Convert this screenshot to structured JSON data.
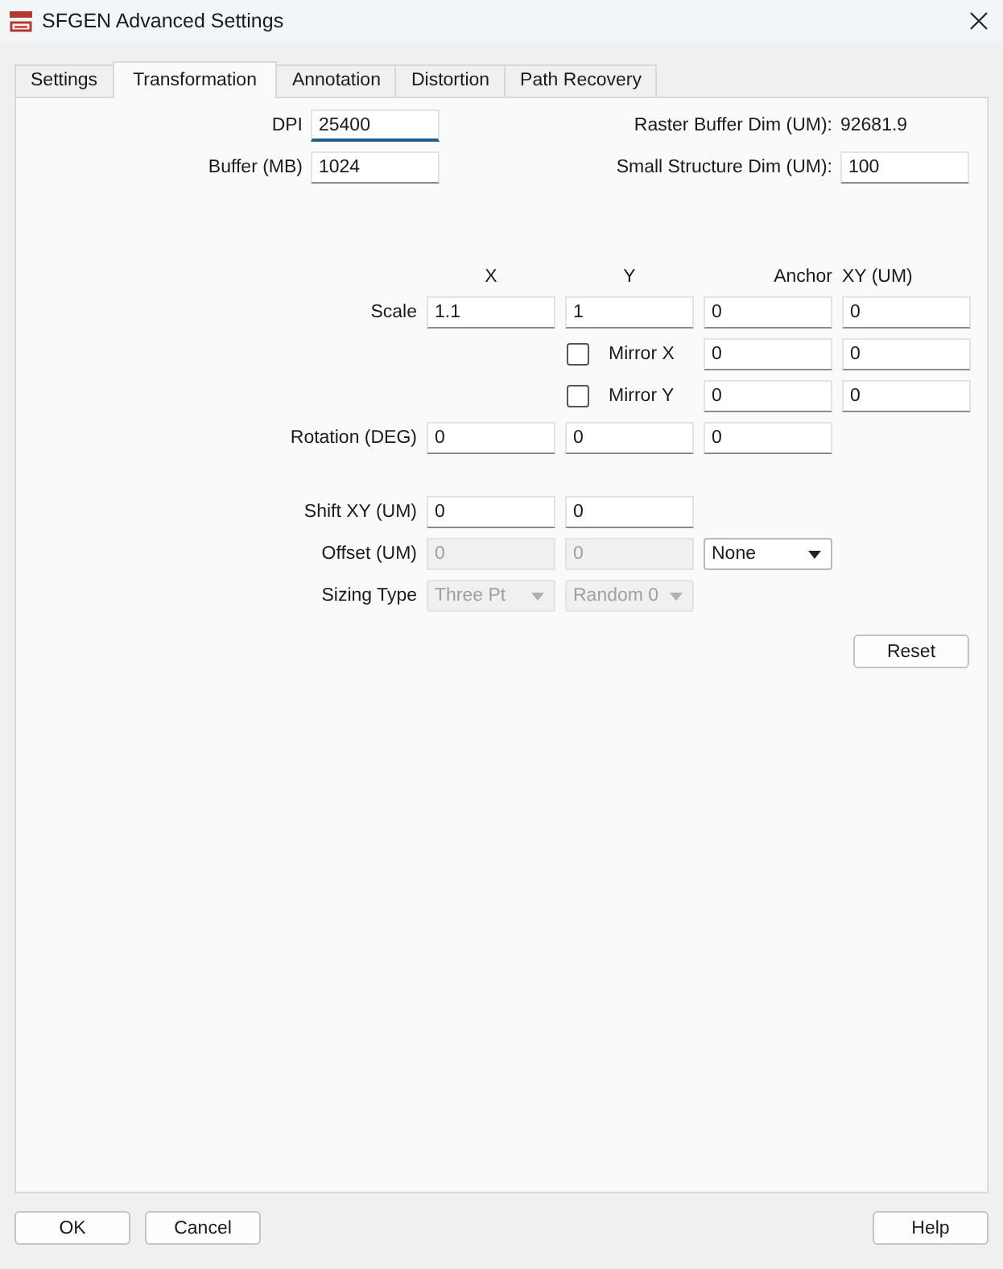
{
  "window": {
    "title": "SFGEN Advanced Settings"
  },
  "tabs": [
    {
      "label": "Settings",
      "selected": false
    },
    {
      "label": "Transformation",
      "selected": true
    },
    {
      "label": "Annotation",
      "selected": false
    },
    {
      "label": "Distortion",
      "selected": false
    },
    {
      "label": "Path Recovery",
      "selected": false
    }
  ],
  "top_left": [
    {
      "label": "DPI",
      "value": "25400",
      "focused": true
    },
    {
      "label": "Buffer (MB)",
      "value": "1024",
      "focused": false
    }
  ],
  "top_right": [
    {
      "label": "Raster Buffer Dim (UM):",
      "kind": "text",
      "value": "92681.9"
    },
    {
      "label": "Small Structure Dim (UM):",
      "kind": "field",
      "value": "100"
    }
  ],
  "column_headers": [
    "X",
    "Y",
    "Anchor",
    "XY (UM)"
  ],
  "sections": [
    {
      "rows": [
        {
          "label": "Scale",
          "cells": [
            {
              "kind": "field",
              "value": "1.1",
              "disabled": false
            },
            {
              "kind": "field",
              "value": "1",
              "disabled": false
            },
            {
              "kind": "field",
              "value": "0",
              "disabled": false
            },
            {
              "kind": "field",
              "value": "0",
              "disabled": false
            }
          ]
        },
        {
          "cells": [
            null,
            {
              "kind": "checkbox",
              "label": "Mirror X",
              "checked": false
            },
            {
              "kind": "field",
              "value": "0",
              "disabled": false
            },
            {
              "kind": "field",
              "value": "0",
              "disabled": false
            }
          ]
        },
        {
          "cells": [
            null,
            {
              "kind": "checkbox",
              "label": "Mirror Y",
              "checked": false
            },
            {
              "kind": "field",
              "value": "0",
              "disabled": false
            },
            {
              "kind": "field",
              "value": "0",
              "disabled": false
            }
          ]
        },
        {
          "label": "Rotation (DEG)",
          "cells": [
            {
              "kind": "field",
              "value": "0",
              "disabled": false
            },
            {
              "kind": "field",
              "value": "0",
              "disabled": false
            },
            {
              "kind": "field",
              "value": "0",
              "disabled": false
            }
          ]
        }
      ]
    },
    {
      "rows": [
        {
          "label": "Shift XY (UM)",
          "cells": [
            {
              "kind": "field",
              "value": "0",
              "disabled": false
            },
            {
              "kind": "field",
              "value": "0",
              "disabled": false
            }
          ]
        },
        {
          "label": "Offset (UM)",
          "cells": [
            {
              "kind": "field",
              "value": "0",
              "disabled": true
            },
            {
              "kind": "field",
              "value": "0",
              "disabled": true
            },
            {
              "kind": "dropdown",
              "value": "None",
              "disabled": false
            }
          ]
        },
        {
          "label": "Sizing Type",
          "cells": [
            {
              "kind": "dropdown",
              "value": "Three Pt",
              "disabled": true
            },
            {
              "kind": "dropdown",
              "value": "Random 0",
              "disabled": true
            }
          ]
        }
      ]
    }
  ],
  "reset_button": "Reset",
  "footer_left": [
    "OK",
    "Cancel"
  ],
  "footer_right": [
    "Help"
  ]
}
